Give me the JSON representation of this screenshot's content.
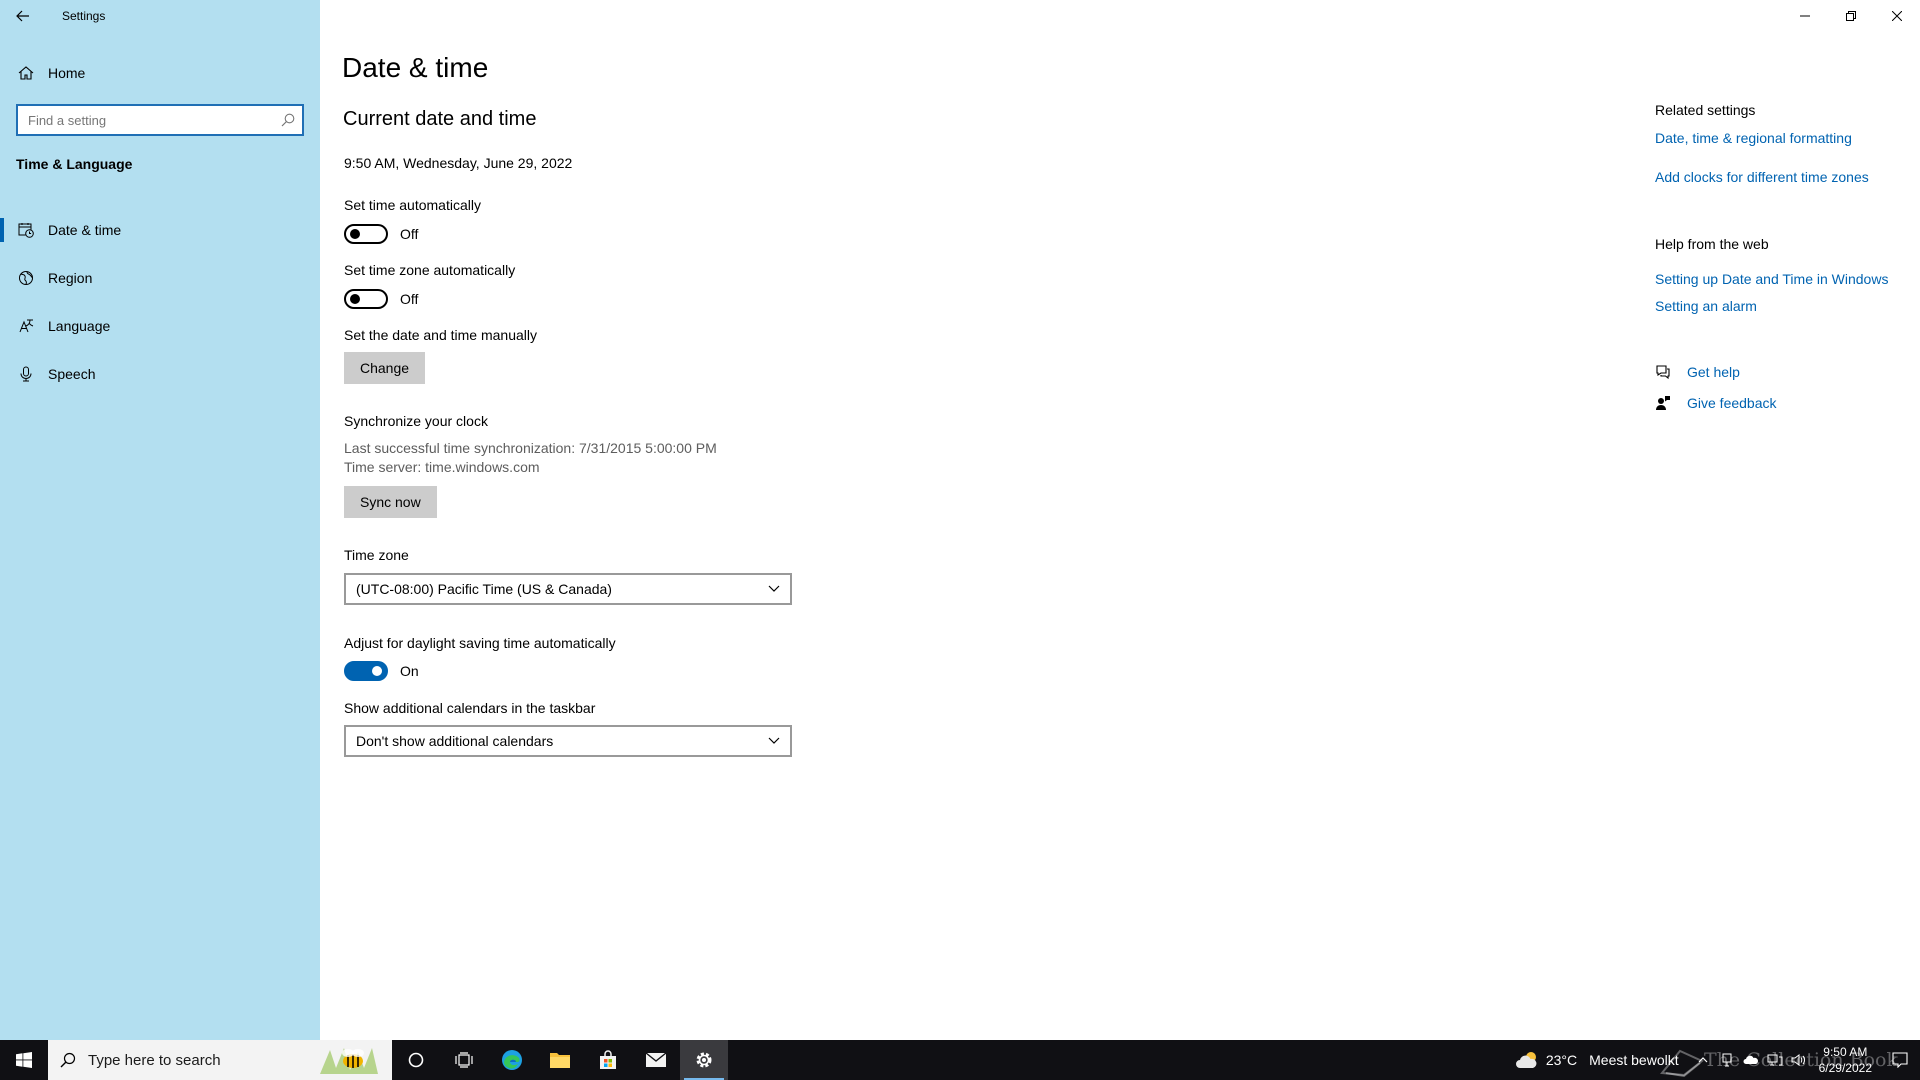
{
  "window": {
    "title": "Settings"
  },
  "sidebar": {
    "home_label": "Home",
    "search_placeholder": "Find a setting",
    "section_heading": "Time & Language",
    "items": [
      {
        "label": "Date & time",
        "icon": "date-time-icon",
        "selected": true
      },
      {
        "label": "Region",
        "icon": "globe-icon",
        "selected": false
      },
      {
        "label": "Language",
        "icon": "language-icon",
        "selected": false
      },
      {
        "label": "Speech",
        "icon": "microphone-icon",
        "selected": false
      }
    ]
  },
  "main": {
    "page_title": "Date & time",
    "current_section": "Current date and time",
    "current_datetime": "9:50 AM, Wednesday, June 29, 2022",
    "set_time_auto": {
      "label": "Set time automatically",
      "state": "Off",
      "on": false
    },
    "set_timezone_auto": {
      "label": "Set time zone automatically",
      "state": "Off",
      "on": false
    },
    "manual": {
      "label": "Set the date and time manually",
      "button": "Change"
    },
    "sync": {
      "heading": "Synchronize your clock",
      "last_sync": "Last successful time synchronization: 7/31/2015 5:00:00 PM",
      "server": "Time server: time.windows.com",
      "button": "Sync now"
    },
    "timezone": {
      "label": "Time zone",
      "value": "(UTC-08:00) Pacific Time (US & Canada)"
    },
    "dst": {
      "label": "Adjust for daylight saving time automatically",
      "state": "On",
      "on": true
    },
    "calendars": {
      "label": "Show additional calendars in the taskbar",
      "value": "Don't show additional calendars"
    }
  },
  "right": {
    "related_heading": "Related settings",
    "related_links": [
      "Date, time & regional formatting",
      "Add clocks for different time zones"
    ],
    "help_heading": "Help from the web",
    "help_links": [
      "Setting up Date and Time in Windows",
      "Setting an alarm"
    ],
    "get_help": "Get help",
    "give_feedback": "Give feedback"
  },
  "taskbar": {
    "search_text": "Type here to search",
    "weather_temp": "23°C",
    "weather_text": "Meest bewolkt",
    "clock_time": "9:50 AM",
    "clock_date": "6/29/2022",
    "watermark": "The Collection Book",
    "accent": "#0063b1"
  },
  "colors": {
    "sidebar_bg": "#b3dff0",
    "accent": "#0063b1",
    "taskbar_bg": "#101014"
  }
}
